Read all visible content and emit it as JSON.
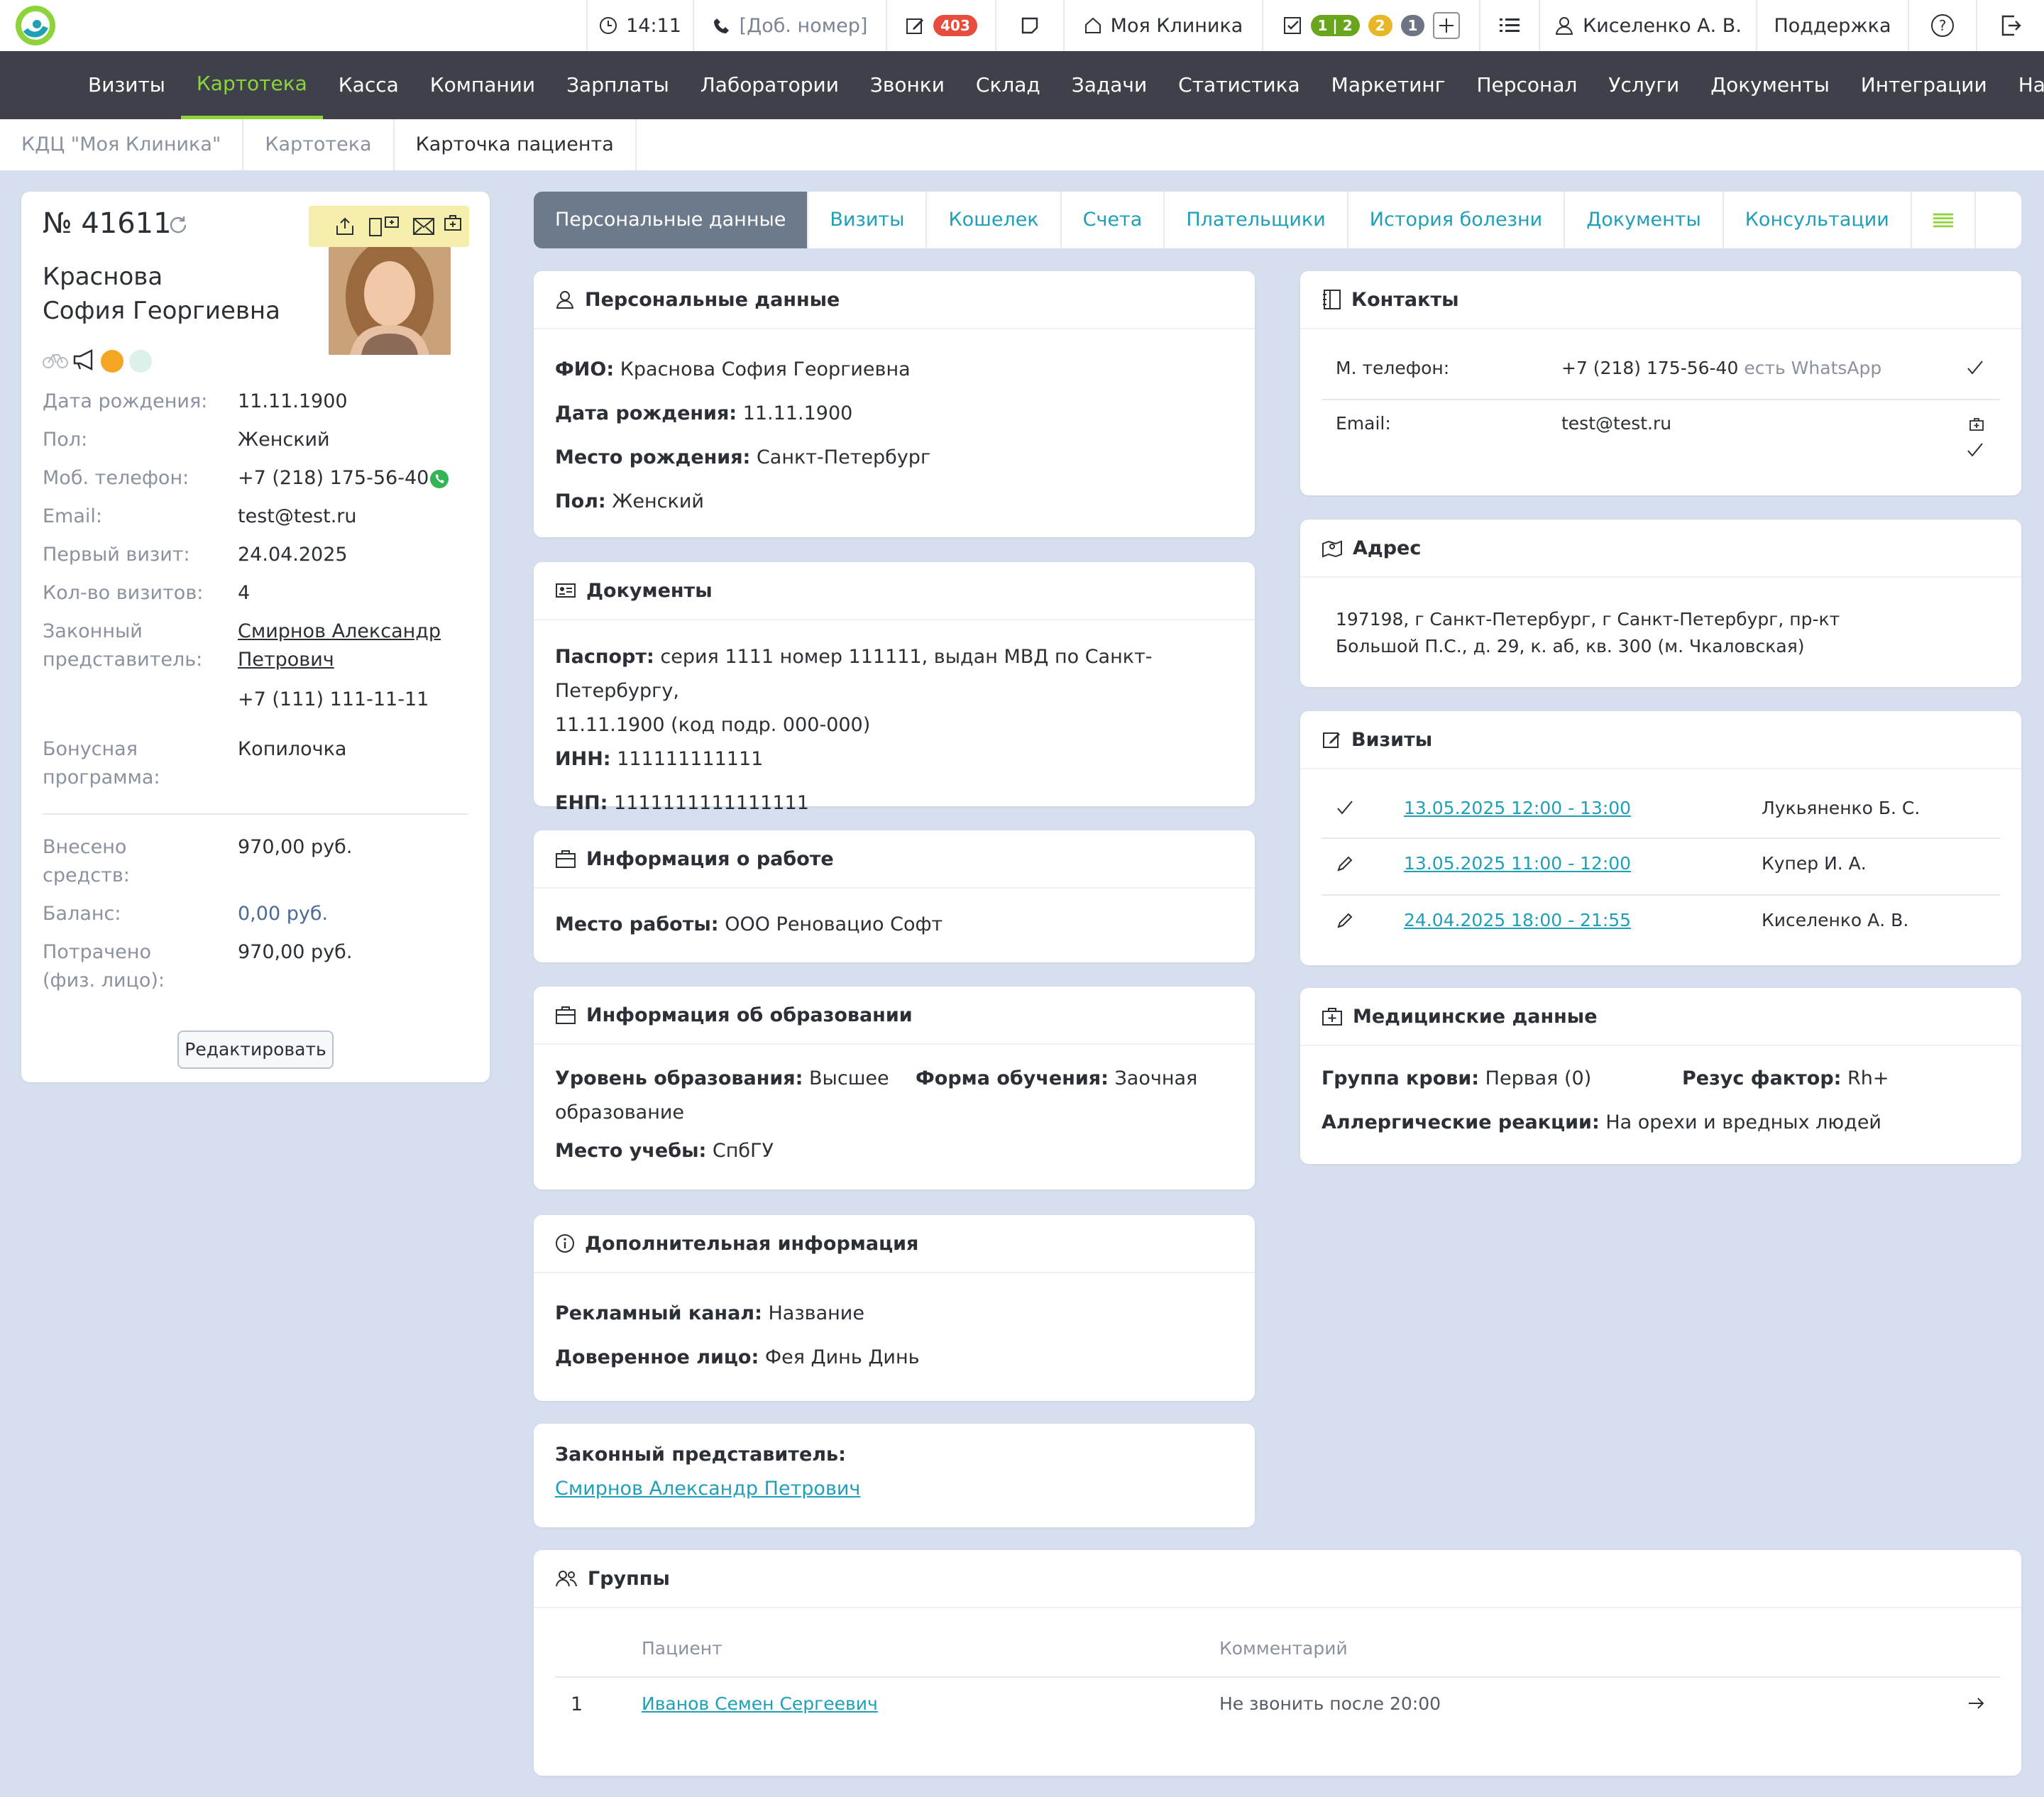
{
  "topbar": {
    "time": "14:11",
    "phone_placeholder": "[Доб. номер]",
    "notes_count": "403",
    "clinic": "Моя Клиника",
    "tasks_badge": "1 | 2",
    "tasks_yellow": "2",
    "tasks_gray": "1",
    "user": "Киселенко А. В.",
    "support": "Поддержка"
  },
  "nav": [
    "Визиты",
    "Картотека",
    "Касса",
    "Компании",
    "Зарплаты",
    "Лаборатории",
    "Звонки",
    "Склад",
    "Задачи",
    "Статистика",
    "Маркетинг",
    "Персонал",
    "Услуги",
    "Документы",
    "Интеграции",
    "Настройки"
  ],
  "breadcrumbs": [
    "КДЦ \"Моя Клиника\"",
    "Картотека",
    "Карточка пациента"
  ],
  "patient": {
    "number": "№ 41611",
    "last_name": "Краснова",
    "first_name": "София Георгиевна",
    "fields": [
      {
        "label": "Дата рождения:",
        "value": "11.11.1900"
      },
      {
        "label": "Пол:",
        "value": "Женский"
      },
      {
        "label": "Моб. телефон:",
        "value": "+7 (218) 175-56-40"
      },
      {
        "label": "Email:",
        "value": "test@test.ru"
      },
      {
        "label": "Первый визит:",
        "value": "24.04.2025"
      },
      {
        "label": "Кол-во визитов:",
        "value": "4"
      }
    ],
    "rep_label_1": "Законный",
    "rep_label_2": "представитель:",
    "rep_name_1": "Смирнов Александр",
    "rep_name_2": "Петрович",
    "rep_phone": "+7 (111) 111-11-11",
    "bonus_label_1": "Бонусная",
    "bonus_label_2": "программа:",
    "bonus_value": "Копилочка",
    "deposit_label_1": "Внесено",
    "deposit_label_2": "средств:",
    "deposit_value": "970,00 руб.",
    "balance_label": "Баланс:",
    "balance_value": "0,00 руб.",
    "spent_label_1": "Потрачено",
    "spent_label_2": "(физ. лицо):",
    "spent_value": "970,00 руб.",
    "edit_button": "Редактировать"
  },
  "tabs": [
    "Персональные данные",
    "Визиты",
    "Кошелек",
    "Счета",
    "Плательщики",
    "История болезни",
    "Документы",
    "Консультации"
  ],
  "personal": {
    "title": "Персональные данные",
    "rows": [
      {
        "k": "ФИО:",
        "v": "Краснова София Георгиевна"
      },
      {
        "k": "Дата рождения:",
        "v": "11.11.1900"
      },
      {
        "k": "Место рождения:",
        "v": "Санкт-Петербург"
      },
      {
        "k": "Пол:",
        "v": "Женский"
      }
    ]
  },
  "documents": {
    "title": "Документы",
    "passport_k": "Паспорт:",
    "passport_v1": "серия 1111 номер 111111, выдан МВД по Санкт-Петербургу,",
    "passport_v2": "11.11.1900 (код подр. 000-000)",
    "inn_k": "ИНН:",
    "inn_v": "111111111111",
    "enp_k": "ЕНП:",
    "enp_v": "1111111111111111"
  },
  "work": {
    "title": "Информация о работе",
    "k": "Место работы:",
    "v": "ООО Реновацио Софт"
  },
  "education": {
    "title": "Информация об образовании",
    "level_k": "Уровень образования:",
    "level_v1": "Высшее",
    "level_v2": "образование",
    "form_k": "Форма обучения:",
    "form_v": "Заочная",
    "place_k": "Место учебы:",
    "place_v": "СпбГУ"
  },
  "extra": {
    "title": "Дополнительная информация",
    "ad_k": "Рекламный канал:",
    "ad_v": "Название",
    "trust_k": "Доверенное лицо:",
    "trust_v": "Фея Динь Динь"
  },
  "legal_rep": {
    "k": "Законный представитель:",
    "v": "Смирнов Александр Петрович"
  },
  "groups": {
    "title": "Группы",
    "col_patient": "Пациент",
    "col_comment": "Комментарий",
    "rows": [
      {
        "n": "1",
        "patient": "Иванов Семен Сергеевич",
        "comment": "Не звонить после 20:00"
      }
    ]
  },
  "contacts": {
    "title": "Контакты",
    "phone_k": "М. телефон:",
    "phone_v": "+7 (218) 175-56-40",
    "phone_note": "есть WhatsApp",
    "email_k": "Email:",
    "email_v": "test@test.ru"
  },
  "address": {
    "title": "Адрес",
    "line1": "197198, г Санкт-Петербург, г Санкт-Петербург, пр-кт",
    "line2": "Большой П.С., д. 29, к. аб, кв. 300 (м. Чкаловская)"
  },
  "visits": {
    "title": "Визиты",
    "rows": [
      {
        "when": "13.05.2025 12:00 - 13:00",
        "doctor": "Лукьяненко Б. С."
      },
      {
        "when": "13.05.2025 11:00 - 12:00",
        "doctor": "Купер И. А."
      },
      {
        "when": "24.04.2025 18:00 - 21:55",
        "doctor": "Киселенко А. В."
      }
    ]
  },
  "medical": {
    "title": "Медицинские данные",
    "blood_k": "Группа крови:",
    "blood_v": "Первая (0)",
    "rh_k": "Резус фактор:",
    "rh_v": "Rh+",
    "allergy_k": "Аллергические реакции:",
    "allergy_v": "На орехи и вредных людей"
  },
  "colors": {
    "accent": "#8dd43a",
    "link": "#1f9fb8",
    "nav_bg": "#3e4149",
    "page_bg": "#d5dfed",
    "badge_red": "#e74c3c"
  }
}
